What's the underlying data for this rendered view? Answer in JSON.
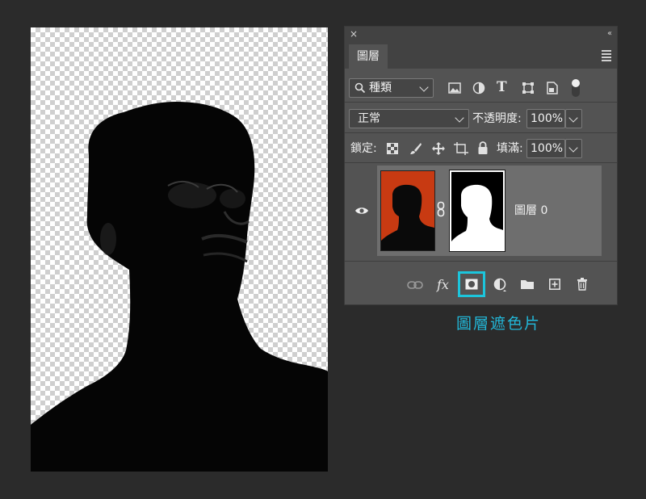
{
  "panel": {
    "close_glyph": "×",
    "collapse_glyph": "‹‹",
    "tab_label": "圖層",
    "filter": {
      "search_glyph": "⌕",
      "kind_label": "種類"
    },
    "blend_mode": "正常",
    "opacity_label": "不透明度:",
    "opacity_value": "100%",
    "lock_label": "鎖定:",
    "fill_label": "填滿:",
    "fill_value": "100%",
    "layers": [
      {
        "name": "圖層 0",
        "visible": true,
        "has_mask": true
      }
    ],
    "bottom_icons": [
      "link-layers-icon",
      "fx-icon",
      "add-mask-icon",
      "adjustment-icon",
      "folder-icon",
      "new-layer-icon",
      "trash-icon"
    ],
    "fx_label": "fx"
  },
  "annotation": {
    "text": "圖層遮色片",
    "color": "#22b7d8"
  },
  "colors": {
    "highlight": "#1cc5dc",
    "thumb_background": "#c83a12"
  }
}
